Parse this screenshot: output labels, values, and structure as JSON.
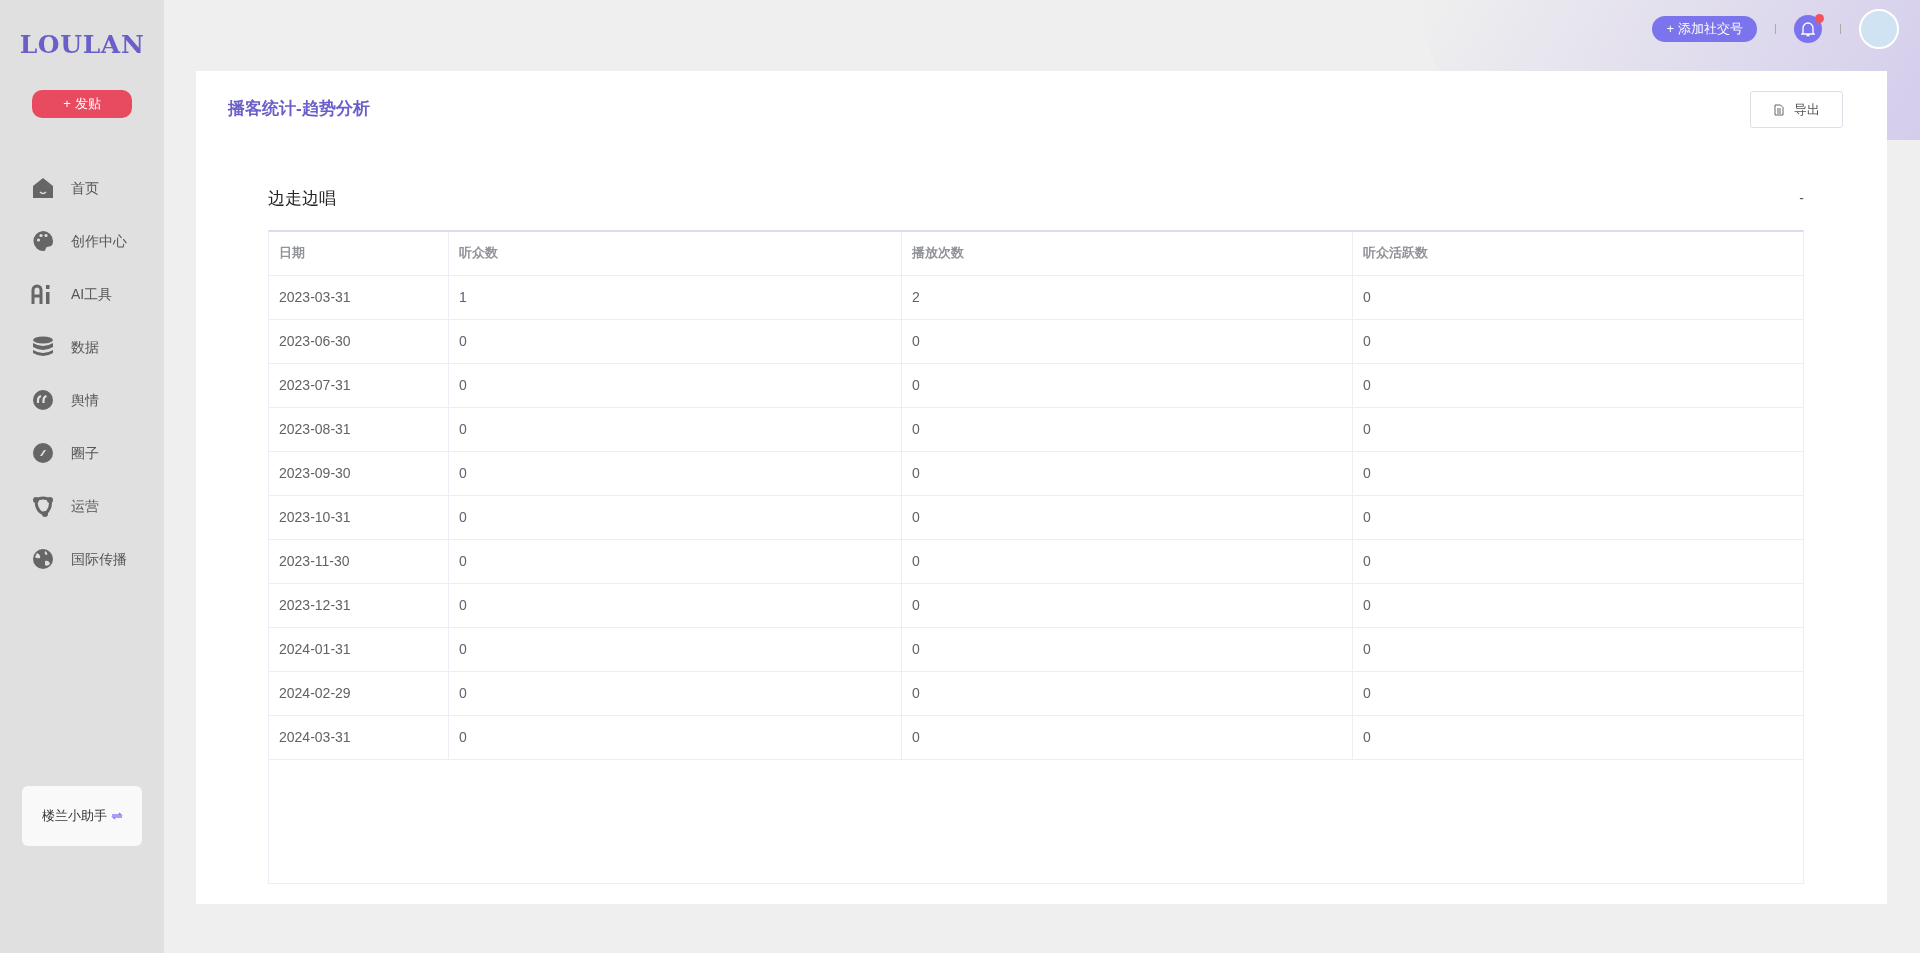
{
  "sidebar": {
    "logo": "LOULAN",
    "post_button": {
      "icon": "+",
      "label": "发贴"
    },
    "items": [
      {
        "label": "首页"
      },
      {
        "label": "创作中心"
      },
      {
        "label": "AI工具"
      },
      {
        "label": "数据"
      },
      {
        "label": "舆情"
      },
      {
        "label": "圈子"
      },
      {
        "label": "运营"
      },
      {
        "label": "国际传播"
      }
    ],
    "assistant": "楼兰小助手"
  },
  "topbar": {
    "add_button": {
      "icon": "+",
      "label": "添加社交号"
    },
    "notification_dot": true
  },
  "page": {
    "title": "播客统计-趋势分析",
    "export_button": "导出",
    "section_title": "边走边唱",
    "section_marker": "-",
    "table": {
      "columns": [
        "日期",
        "听众数",
        "播放次数",
        "听众活跃数"
      ],
      "rows": [
        [
          "2023-03-31",
          "1",
          "2",
          "0"
        ],
        [
          "2023-06-30",
          "0",
          "0",
          "0"
        ],
        [
          "2023-07-31",
          "0",
          "0",
          "0"
        ],
        [
          "2023-08-31",
          "0",
          "0",
          "0"
        ],
        [
          "2023-09-30",
          "0",
          "0",
          "0"
        ],
        [
          "2023-10-31",
          "0",
          "0",
          "0"
        ],
        [
          "2023-11-30",
          "0",
          "0",
          "0"
        ],
        [
          "2023-12-31",
          "0",
          "0",
          "0"
        ],
        [
          "2024-01-31",
          "0",
          "0",
          "0"
        ],
        [
          "2024-02-29",
          "0",
          "0",
          "0"
        ],
        [
          "2024-03-31",
          "0",
          "0",
          "0"
        ]
      ]
    }
  }
}
